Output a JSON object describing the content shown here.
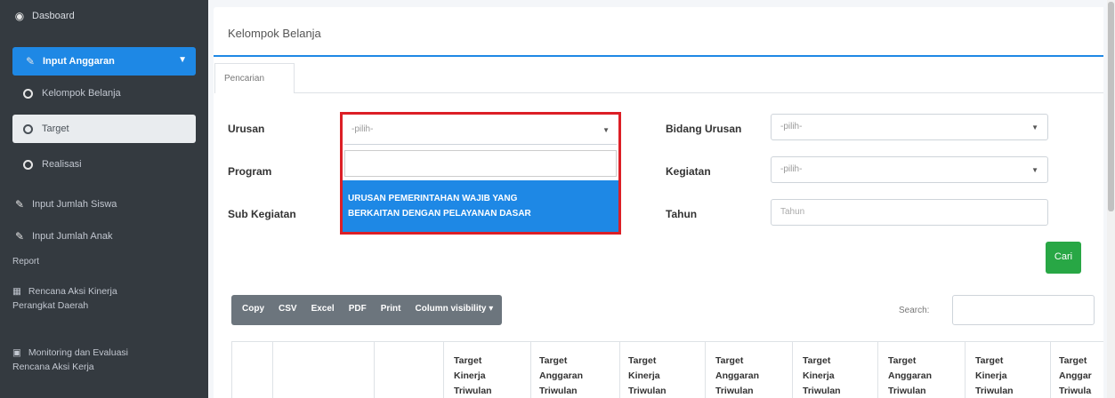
{
  "sidebar": {
    "dashboard": "Dasboard",
    "input_anggaran": "Input Anggaran",
    "sub_items": [
      "Kelompok Belanja",
      "Target",
      "Realisasi"
    ],
    "input_jumlah_siswa": "Input Jumlah Siswa",
    "input_jumlah_anak": "Input Jumlah Anak",
    "report_header": "Report",
    "rencana_line1": "Rencana Aksi Kinerja",
    "rencana_line2": "Perangkat Daerah",
    "monitoring_line1": "Monitoring dan Evaluasi",
    "monitoring_line2": "Rencana Aksi Kerja"
  },
  "card": {
    "title": "Kelompok Belanja",
    "tab": "Pencarian"
  },
  "form": {
    "urusan_label": "Urusan",
    "urusan_value": "-pilih-",
    "program_label": "Program",
    "sub_kegiatan_label": "Sub Kegiatan",
    "bidang_urusan_label": "Bidang Urusan",
    "bidang_urusan_value": "-pilih-",
    "kegiatan_label": "Kegiatan",
    "kegiatan_value": "-pilih-",
    "tahun_label": "Tahun",
    "tahun_placeholder": "Tahun",
    "cari_button": "Cari"
  },
  "dropdown": {
    "option_line1": "URUSAN PEMERINTAHAN WAJIB YANG",
    "option_line2": "BERKAITAN DENGAN PELAYANAN DASAR"
  },
  "toolbar": {
    "buttons": [
      "Copy",
      "CSV",
      "Excel",
      "PDF",
      "Print",
      "Column visibility ▾"
    ],
    "search_label": "Search:"
  },
  "table": {
    "headers": [
      [
        "Target",
        "Kinerja",
        "Triwulan"
      ],
      [
        "Target",
        "Anggaran",
        "Triwulan"
      ],
      [
        "Target",
        "Kinerja",
        "Triwulan"
      ],
      [
        "Target",
        "Anggaran",
        "Triwulan"
      ],
      [
        "Target",
        "Kinerja",
        "Triwulan"
      ],
      [
        "Target",
        "Anggaran",
        "Triwulan"
      ],
      [
        "Target",
        "Kinerja",
        "Triwulan"
      ],
      [
        "Target",
        "Anggar",
        "Triwula"
      ]
    ]
  }
}
